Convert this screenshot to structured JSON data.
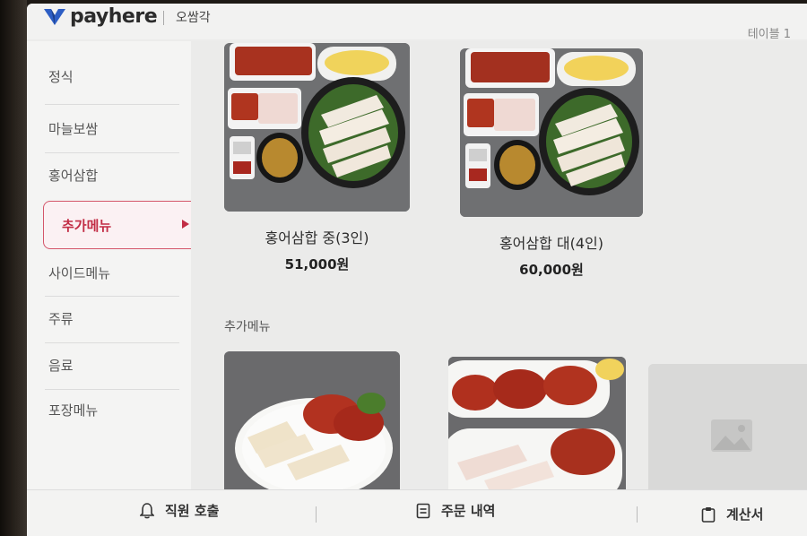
{
  "header": {
    "brand": "payhere",
    "store": "오쌈각",
    "table": "테이블 1",
    "brand_color": "#2d5ec4"
  },
  "sidebar": {
    "items": [
      {
        "label": "정식"
      },
      {
        "label": "마늘보쌈"
      },
      {
        "label": "홍어삼합"
      },
      {
        "label": "추가메뉴",
        "active": true
      },
      {
        "label": "사이드메뉴"
      },
      {
        "label": "주류"
      },
      {
        "label": "음료"
      },
      {
        "label": "포장메뉴"
      }
    ],
    "accent": "#c22d45"
  },
  "main": {
    "cards": [
      {
        "name": "홍어삼합 중(3인)",
        "price": "51,000원"
      },
      {
        "name": "홍어삼합 대(4인)",
        "price": "60,000원"
      }
    ],
    "section_title": "추가메뉴"
  },
  "footer": {
    "call_staff": "직원 호출",
    "order_history": "주문 내역",
    "bill": "계산서"
  }
}
